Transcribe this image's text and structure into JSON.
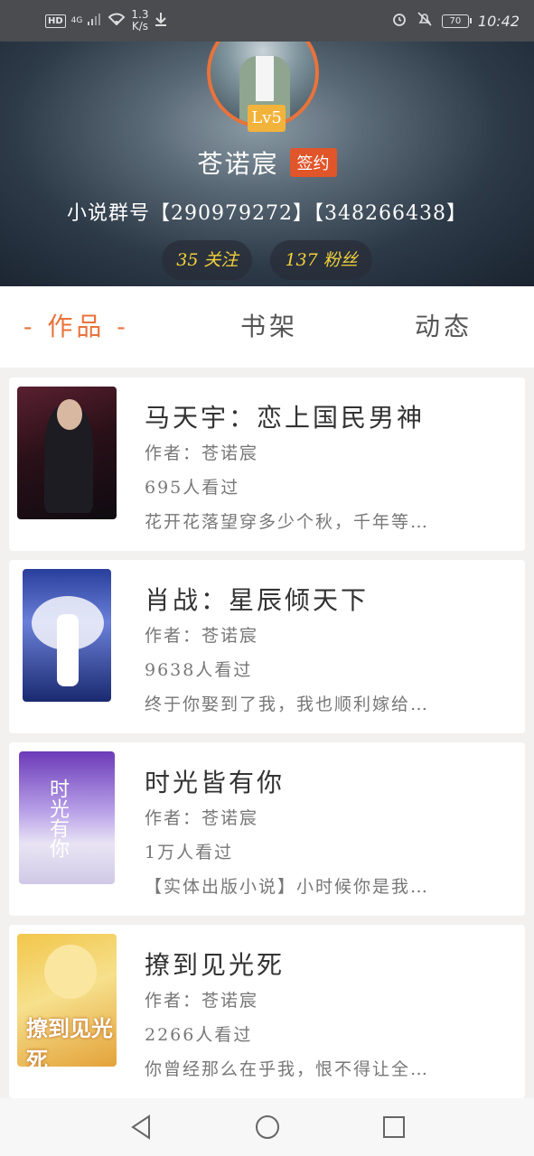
{
  "status_bar": {
    "hd": "HD",
    "network": "4G",
    "speed_value": "1.3",
    "speed_unit": "K/s",
    "battery": "70",
    "time": "10:42"
  },
  "profile": {
    "level": "Lv5",
    "username": "苍诺宸",
    "sign_badge": "签约",
    "group_info": "小说群号【290979272】【348266438】",
    "following": "35 关注",
    "followers": "137 粉丝"
  },
  "tabs": [
    {
      "label": "- 作品 -",
      "active": true
    },
    {
      "label": "书架",
      "active": false
    },
    {
      "label": "动态",
      "active": false
    }
  ],
  "books": [
    {
      "title": "马天宇：恋上国民男神",
      "author": "作者：苍诺宸",
      "views": "695人看过",
      "desc": "花开花落望穿多少个秋，千年等…"
    },
    {
      "title": "肖战：星辰倾天下",
      "author": "作者：苍诺宸",
      "views": "9638人看过",
      "desc": "终于你娶到了我，我也顺利嫁给…"
    },
    {
      "title": "时光皆有你",
      "author": "作者：苍诺宸",
      "views": "1万人看过",
      "desc": "【实体出版小说】小时候你是我…",
      "cover_text": "时光有你"
    },
    {
      "title": "撩到见光死",
      "author": "作者：苍诺宸",
      "views": "2266人看过",
      "desc": "你曾经那么在乎我，恨不得让全…",
      "cover_text": "撩到见光死"
    }
  ],
  "nav": {
    "back_icon": "back-triangle-icon",
    "home_icon": "home-circle-icon",
    "recents_icon": "recents-square-icon"
  },
  "colors": {
    "accent": "#e8733b",
    "sign_badge": "#e0552a",
    "level_badge": "#f2b33b",
    "stat_text": "#f3d23b"
  }
}
